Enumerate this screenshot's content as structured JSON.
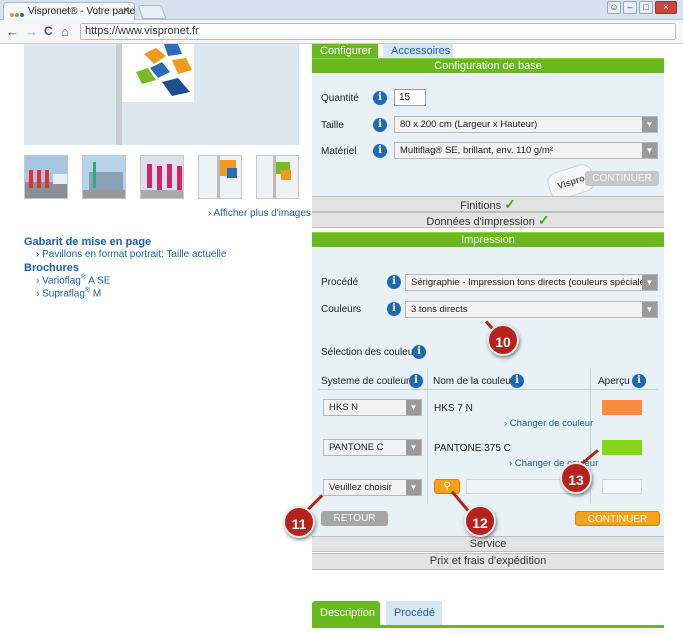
{
  "browser": {
    "tab_title": "Vispronet® - Votre parte",
    "url": "https://www.vispronet.fr",
    "close": "×",
    "back": "←",
    "forward": "→",
    "reload": "C",
    "home": "⌂"
  },
  "gallery": {
    "more_images": "› Afficher plus d'images"
  },
  "sidebar": {
    "template_title": "Gabarit de mise en page",
    "template_link": "› Pavillons en format portrait: Taille actuelle",
    "brochures_title": "Brochures",
    "brochure_1_pre": "› Varioflag",
    "brochure_1_post": " A SE",
    "brochure_2_pre": "› Supraflag",
    "brochure_2_post": " M",
    "reg": "®"
  },
  "tabs": {
    "configure": "Configurer",
    "accessories": "Accessoires"
  },
  "config_base": {
    "header": "Configuration de base",
    "quantity_label": "Quantité",
    "quantity_value": "15",
    "size_label": "Taille",
    "size_value": "80 x 200 cm (Largeur x Hauteur)",
    "material_label": "Matériel",
    "material_value": "Multiflag® SE, brillant, env. 110 g/m²",
    "continue": "CONTINUER",
    "stamp": "Vispro"
  },
  "sections": {
    "finitions": "Finitions",
    "print_data": "Données d'impression",
    "impression": "Impression",
    "service": "Service",
    "price": "Prix et frais d'expédition"
  },
  "impression": {
    "process_label": "Procédé",
    "process_value": "Sérigraphie - Impression tons directs (couleurs spéciales)",
    "colors_label": "Couleurs",
    "colors_value": "3 tons directs",
    "selection_label": "Sélection des couleurs",
    "col_system": "Systeme de couleurs",
    "col_name": "Nom de la couleur",
    "col_preview": "Aperçu",
    "rows": [
      {
        "system": "HKS N",
        "name": "HKS 7 N",
        "change": "› Changer de couleur",
        "color": "#ff8a3d"
      },
      {
        "system": "PANTONE C",
        "name": "PANTONE 375 C",
        "change": "› Changer de couleur",
        "color": "#86d618"
      },
      {
        "system": "Veuillez choisir",
        "name": "",
        "change": "",
        "color": ""
      }
    ],
    "back": "RETOUR",
    "continue": "CONTINUER"
  },
  "markers": {
    "m10": "10",
    "m11": "11",
    "m12": "12",
    "m13": "13"
  },
  "bottom_tabs": {
    "description": "Description",
    "process": "Procédé"
  },
  "colors": {
    "accent_green": "#6ab820",
    "link_blue": "#1d5fa8",
    "button_orange": "#f4a21c",
    "marker_red": "#b5231c"
  }
}
